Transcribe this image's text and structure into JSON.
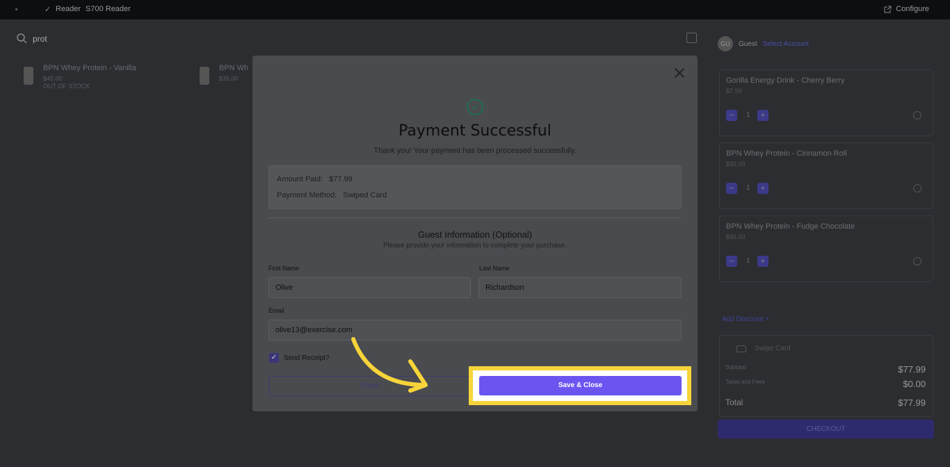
{
  "topbar": {
    "reader_label": "Reader",
    "reader_name": "S700 Reader",
    "configure_label": "Configure"
  },
  "search": {
    "value": "prot"
  },
  "products": [
    {
      "name": "BPN Whey Protein - Vanilla",
      "price": "$45.00",
      "stock": "OUT OF STOCK"
    },
    {
      "name": "BPN Wh",
      "price": "$35.00"
    }
  ],
  "cart": {
    "avatar_initials": "GU",
    "guest_label": "Guest",
    "select_account_label": "Select Account",
    "items": [
      {
        "name": "Gorilla Energy Drink - Cherry Berry",
        "price": "$7.99",
        "qty": "1"
      },
      {
        "name": "BPN Whey Protein - Cinnamon Roll",
        "price": "$35.00",
        "qty": "1"
      },
      {
        "name": "BPN Whey Protein - Fudge Chocolate",
        "price": "$35.00",
        "qty": "1"
      }
    ],
    "add_discount_label": "Add Discount",
    "payment_method_label": "Swipe Card",
    "subtotal_label": "Subtotal",
    "subtotal_value": "$77.99",
    "tax_label": "Taxes and Fees",
    "tax_value": "$0.00",
    "total_label": "Total",
    "total_value": "$77.99",
    "checkout_label": "CHECKOUT"
  },
  "modal": {
    "title": "Payment Successful",
    "subtitle": "Thank you! Your payment has been processed successfully.",
    "amount_paid_label": "Amount Paid:",
    "amount_paid_value": "$77.99",
    "payment_method_label": "Payment Method:",
    "payment_method_value": "Swiped Card",
    "guest_title": "Guest Information (Optional)",
    "guest_subtitle": "Please provide your information to complete your purchase.",
    "first_name_label": "First Name",
    "first_name_value": "Olive",
    "last_name_label": "Last Name",
    "last_name_value": "Richardson",
    "email_label": "Email",
    "email_value": "olive13@exercise.com",
    "send_receipt_label": "Send Receipt?",
    "close_button_label": "Close",
    "save_button_label": "Save & Close"
  },
  "colors": {
    "highlight": "#f7d53a",
    "primary_button": "#6a55f0",
    "success_icon": "#1f6d52"
  }
}
